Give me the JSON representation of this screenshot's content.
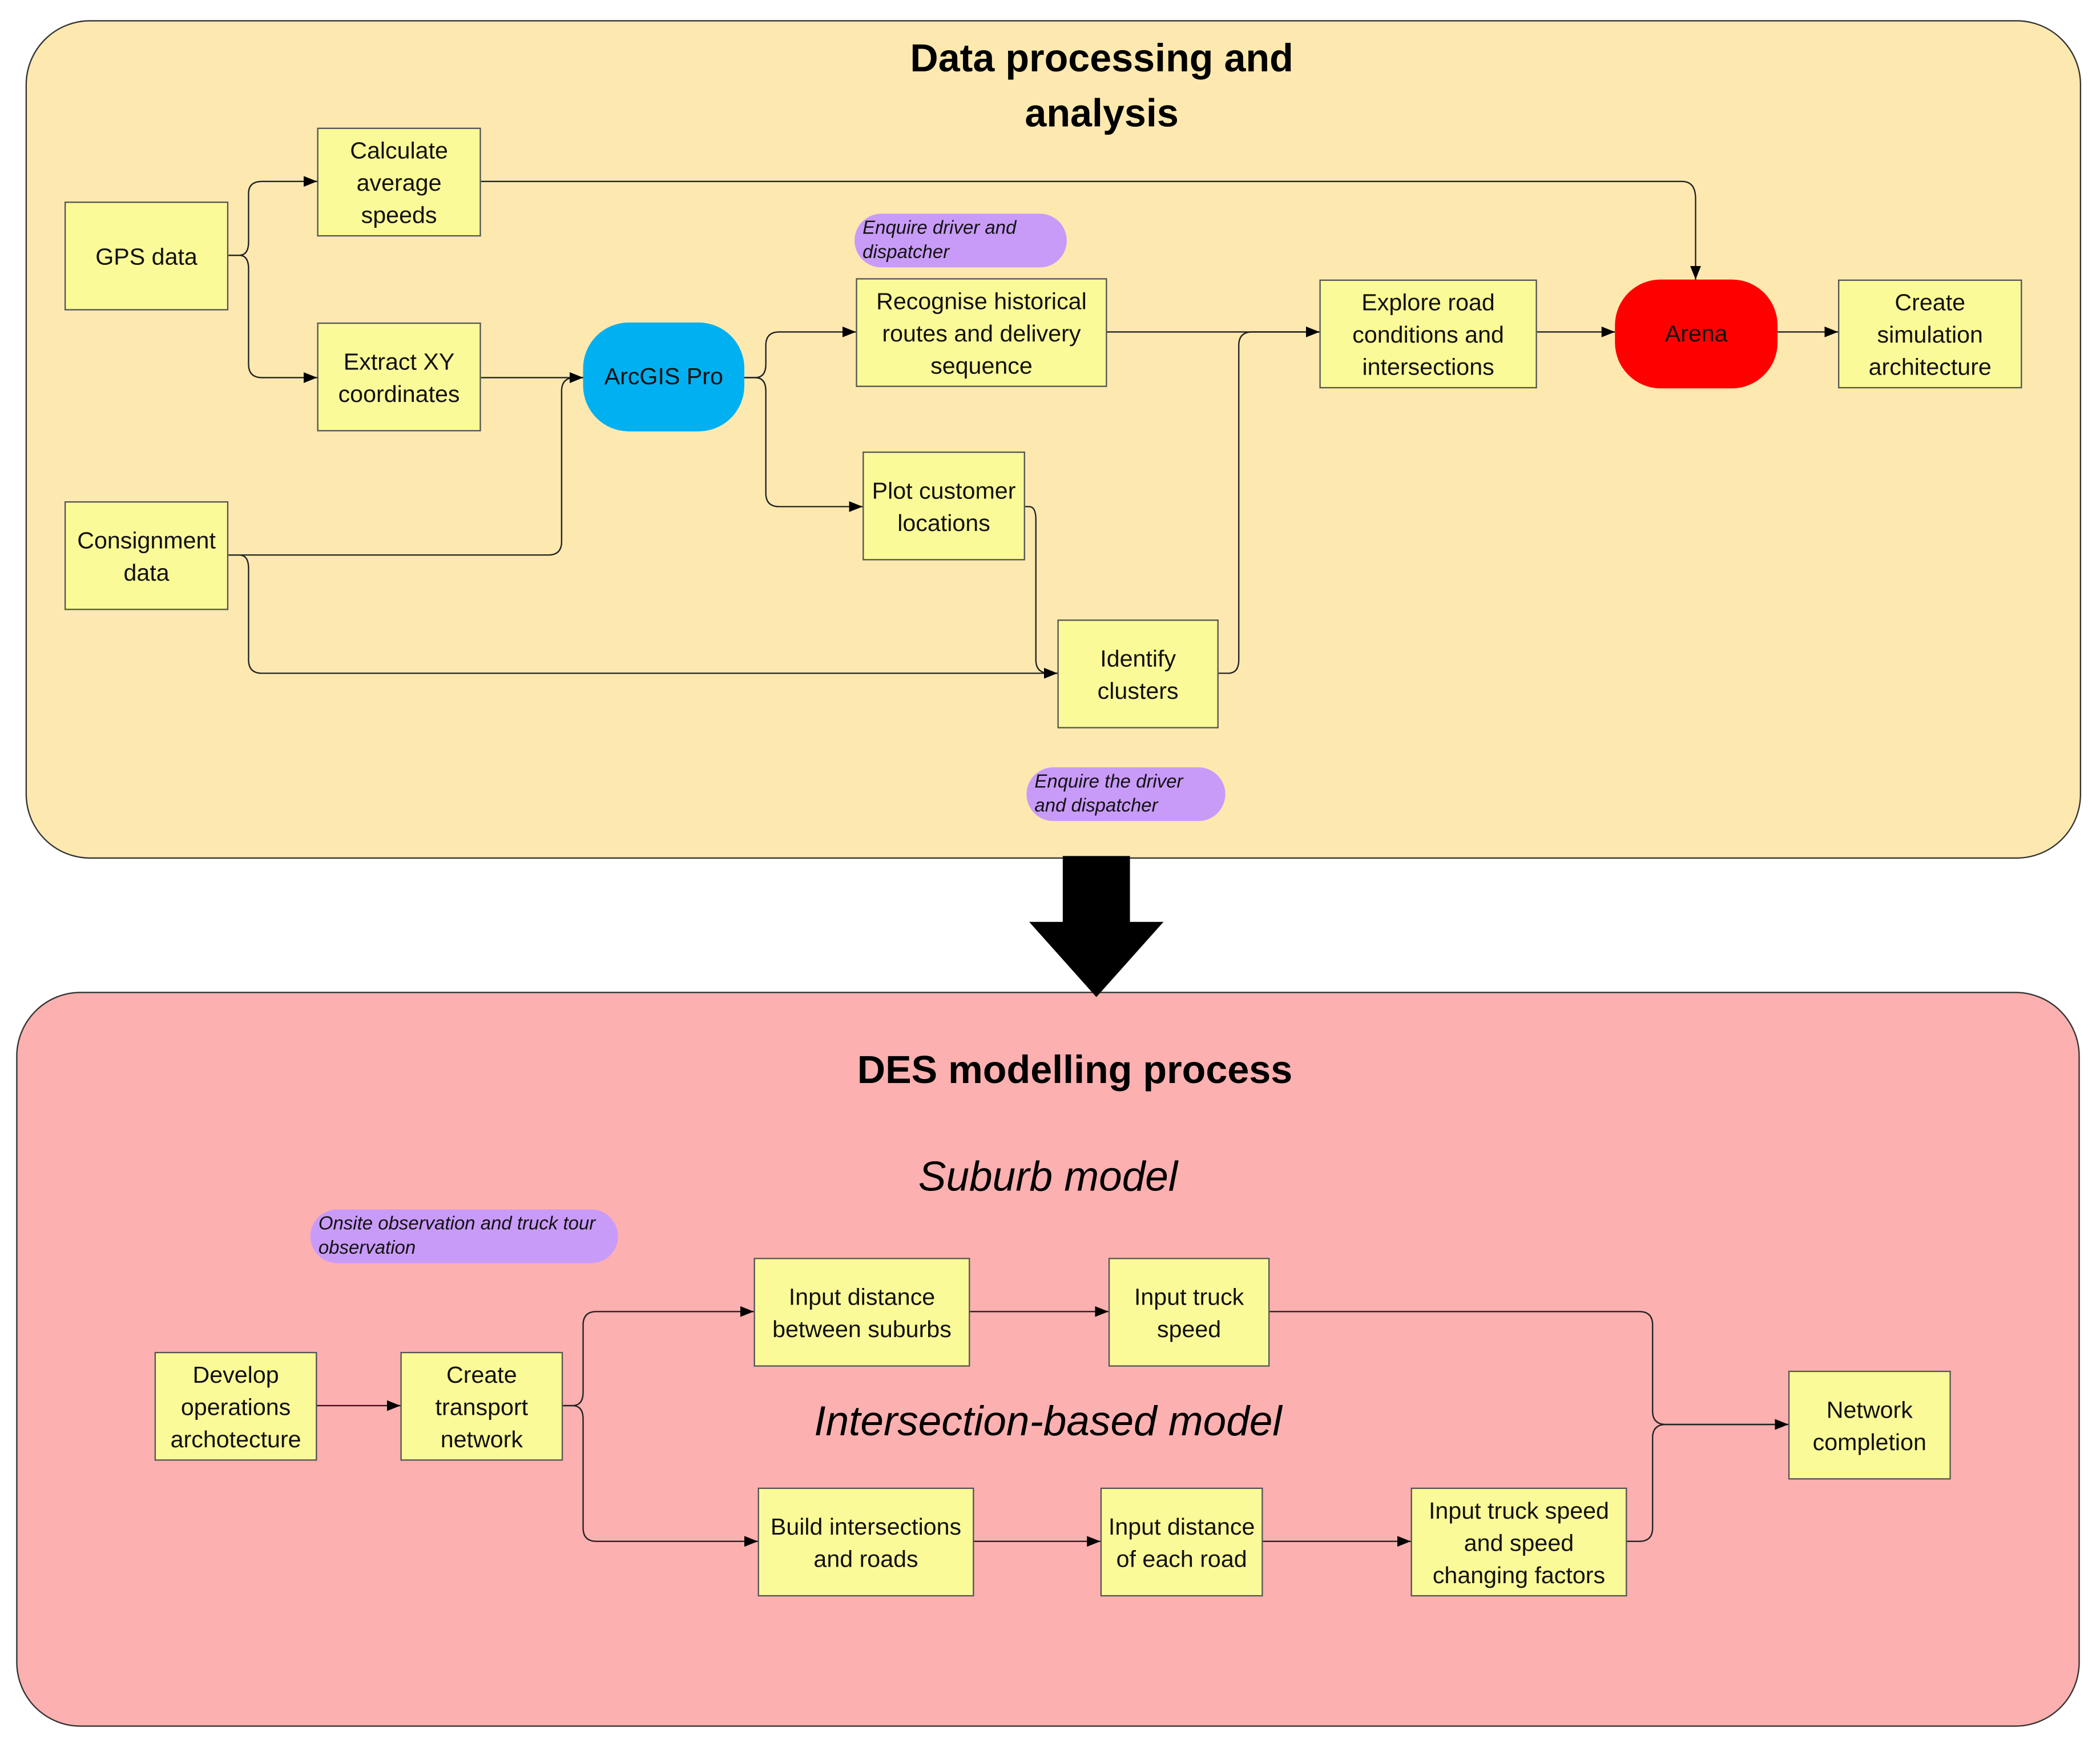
{
  "sections": {
    "top": {
      "title_line1": "Data processing and",
      "title_line2": "analysis",
      "color": "#fde9b0",
      "nodes": {
        "gps": "GPS data",
        "consignment": "Consignment data",
        "calc_speeds": "Calculate average speeds",
        "extract_xy": "Extract XY coordinates",
        "arcgis": "ArcGIS Pro",
        "recognise": "Recognise historical routes and delivery sequence",
        "plot": "Plot customer locations",
        "clusters": "Identify clusters",
        "explore": "Explore road conditions and intersections",
        "arena": "Arena",
        "create_sim": "Create simulation architecture"
      },
      "notes": {
        "enquire1": "Enquire driver and dispatcher",
        "enquire2": "Enquire the driver and dispatcher"
      }
    },
    "bottom": {
      "title": "DES modelling process",
      "color": "#fdb0b0",
      "suburb_label": "Suburb model",
      "intersection_label": "Intersection-based model",
      "nodes": {
        "develop": "Develop operations archotecture",
        "create_network": "Create transport network",
        "input_distance_suburbs": "Input distance between suburbs",
        "input_truck_speed": "Input truck speed",
        "build_intersections": "Build intersections and roads",
        "input_distance_road": "Input distance of each road",
        "input_speed_factors": "Input truck speed and speed changing factors",
        "network_completion": "Network completion"
      },
      "notes": {
        "onsite": "Onsite observation and truck tour observation"
      }
    }
  },
  "colors": {
    "box": "#fbfa98",
    "arcgis": "#00b0f0",
    "arena": "#ff0000",
    "note": "#c99bf9"
  }
}
